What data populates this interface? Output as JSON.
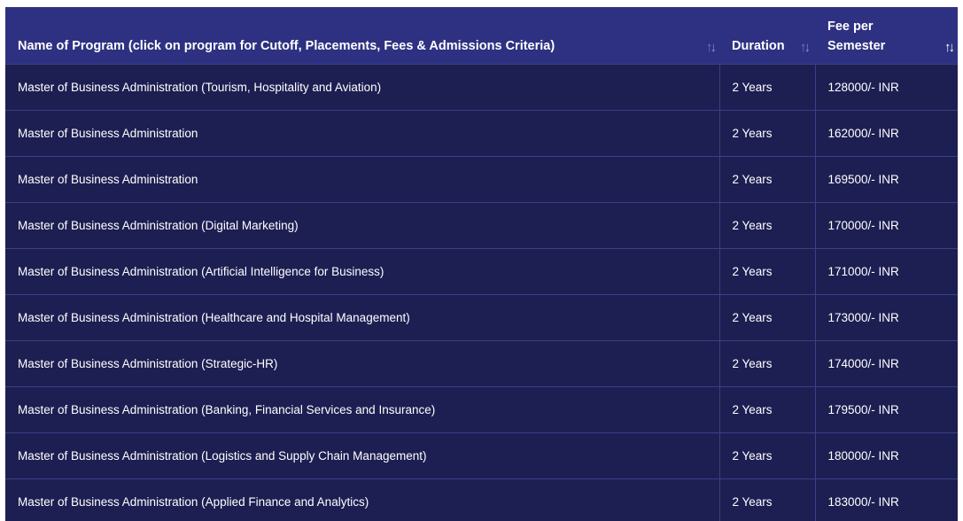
{
  "table": {
    "headers": {
      "program": "Name of Program (click on program for Cutoff, Placements, Fees & Admissions Criteria)",
      "duration": "Duration",
      "fee_line1": "Fee per",
      "fee_line2": "Semester",
      "sort_glyph_up": "↑",
      "sort_glyph_down": "↓"
    },
    "rows": [
      {
        "program": "Master of Business Administration (Tourism, Hospitality and Aviation)",
        "duration": "2 Years",
        "fee": "128000/- INR"
      },
      {
        "program": "Master of Business Administration",
        "duration": "2 Years",
        "fee": "162000/- INR"
      },
      {
        "program": "Master of Business Administration",
        "duration": "2 Years",
        "fee": "169500/- INR"
      },
      {
        "program": "Master of Business Administration (Digital Marketing)",
        "duration": "2 Years",
        "fee": "170000/- INR"
      },
      {
        "program": "Master of Business Administration (Artificial Intelligence for Business)",
        "duration": "2 Years",
        "fee": "171000/- INR"
      },
      {
        "program": "Master of Business Administration (Healthcare and Hospital Management)",
        "duration": "2 Years",
        "fee": "173000/- INR"
      },
      {
        "program": "Master of Business Administration (Strategic-HR)",
        "duration": "2 Years",
        "fee": "174000/- INR"
      },
      {
        "program": "Master of Business Administration (Banking, Financial Services and Insurance)",
        "duration": "2 Years",
        "fee": "179500/- INR"
      },
      {
        "program": "Master of Business Administration (Logistics and Supply Chain Management)",
        "duration": "2 Years",
        "fee": "180000/- INR"
      },
      {
        "program": "Master of Business Administration (Applied Finance and Analytics)",
        "duration": "2 Years",
        "fee": "183000/- INR"
      }
    ]
  },
  "colors": {
    "header_bg": "#2e3181",
    "row_bg": "#1d1f52",
    "divider": "#3b3f86",
    "text": "#ffffff"
  }
}
